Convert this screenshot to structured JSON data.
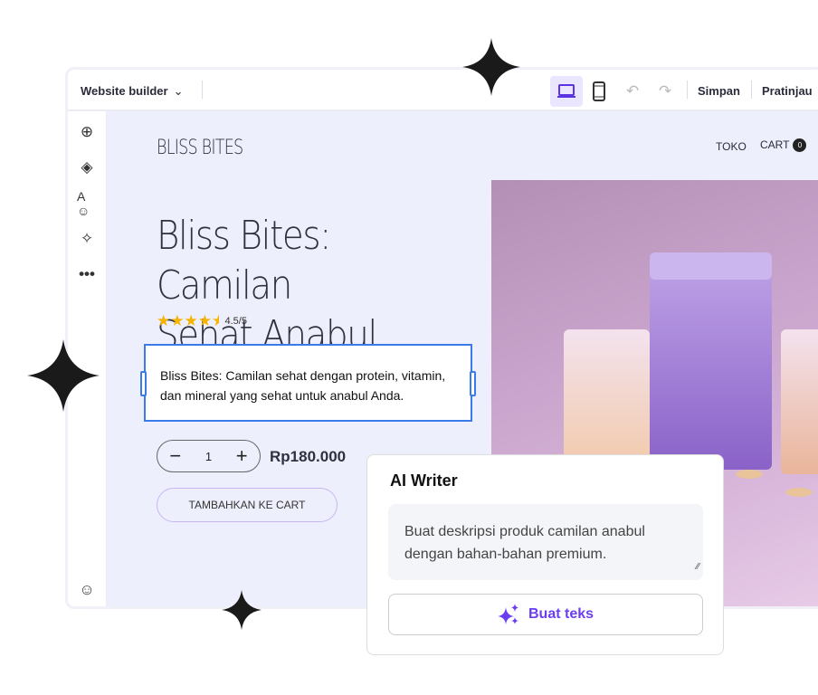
{
  "topbar": {
    "title": "Website builder",
    "save": "Simpan",
    "preview": "Pratinjau",
    "devices": [
      "laptop-icon",
      "mobile-icon"
    ],
    "active_device": "laptop"
  },
  "sidebar": {
    "items": [
      "add-icon",
      "layers-icon",
      "theme-icon",
      "ai-sparkle-icon",
      "more-icon"
    ],
    "bottom": "feedback-icon"
  },
  "site": {
    "logo": "BLISS BITES",
    "nav": [
      "TOKO",
      "CART"
    ],
    "cart_count": "0",
    "title_line1": "Bliss Bites: Camilan",
    "title_line2": "Sehat Anabul",
    "rating_value": 4.5,
    "rating_text": "4.5/5",
    "description": "Bliss Bites: Camilan sehat dengan protein, vitamin, dan mineral yang sehat untuk anabul Anda.",
    "quantity": "1",
    "price": "Rp180.000",
    "add_to_cart": "TAMBAHKAN KE CART"
  },
  "ai_writer": {
    "title": "AI Writer",
    "prompt": "Buat deskripsi produk camilan anabul dengan bahan-bahan premium.",
    "button": "Buat teks"
  },
  "colors": {
    "accent": "#6b3ef0",
    "selection": "#3b7be8",
    "canvas": "#eeeffc",
    "star": "#f4b400"
  }
}
